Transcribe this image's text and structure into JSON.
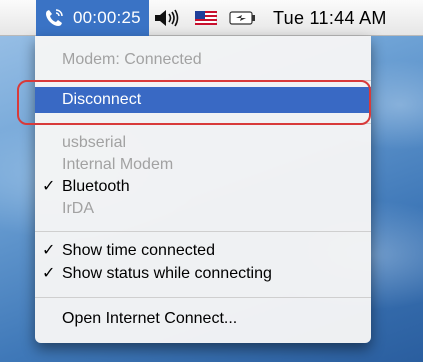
{
  "menubar": {
    "connection_timer": "00:00:25",
    "clock": "Tue 11:44 AM",
    "icons": [
      "modem-phone-icon",
      "volume-icon",
      "us-flag-icon",
      "battery-icon"
    ]
  },
  "menu": {
    "status": "Modem: Connected",
    "disconnect": "Disconnect",
    "devices": {
      "usbserial": "usbserial",
      "internal_modem": "Internal Modem",
      "bluetooth": "Bluetooth",
      "irda": "IrDA"
    },
    "options": {
      "show_time": "Show time connected",
      "show_status": "Show status while connecting"
    },
    "open_internet_connect": "Open Internet Connect...",
    "checkmark": "✓"
  },
  "colors": {
    "selection": "#3969c4",
    "annotation_ring": "#d83a3a",
    "disabled_text": "#a2a2a2"
  }
}
